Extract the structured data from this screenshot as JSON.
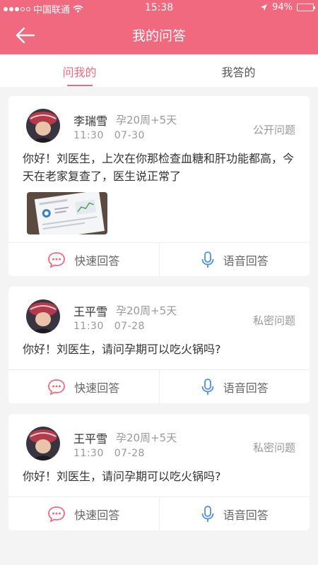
{
  "status": {
    "carrier": "中国联通",
    "time": "15:38",
    "battery": "94%",
    "battery_level": 0.94
  },
  "header": {
    "title": "我的问答"
  },
  "tabs": [
    {
      "label": "问我的",
      "active": true
    },
    {
      "label": "我答的",
      "active": false
    }
  ],
  "questions": [
    {
      "name": "李瑞雪",
      "pregnancy": "孕20周+5天",
      "time": "11:30",
      "date": "07-30",
      "type": "公开问题",
      "content": "你好！刘医生，上次在你那检查血糖和肝功能都高，今天在老家复查了，医生说正常了"
    },
    {
      "name": "王平雪",
      "pregnancy": "孕20周+5天",
      "time": "11:30",
      "date": "07-28",
      "type": "私密问题",
      "content": "你好！刘医生，请问孕期可以吃火锅吗?"
    },
    {
      "name": "王平雪",
      "pregnancy": "孕20周+5天",
      "time": "11:30",
      "date": "07-28",
      "type": "私密问题",
      "content": "你好！刘医生，请问孕期可以吃火锅吗?"
    }
  ],
  "actions": {
    "quick": "快速回答",
    "voice": "语音回答"
  },
  "colors": {
    "accent": "#f0697f",
    "quick_icon": "#f0697f",
    "voice_icon": "#4a90e2"
  },
  "icons": {
    "back": "back-arrow-icon",
    "quick": "chat-bubble-icon",
    "voice": "microphone-icon"
  }
}
